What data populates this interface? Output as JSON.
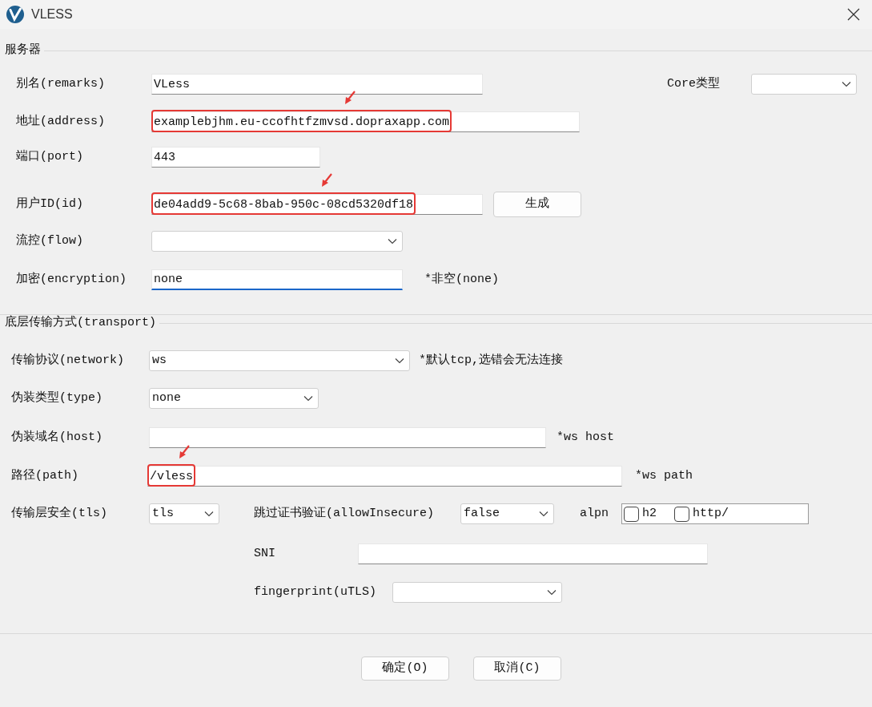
{
  "window": {
    "title": "VLESS"
  },
  "sections": [
    {
      "title": "服务器",
      "rows": [
        {
          "items": [
            {
              "kind": "label",
              "text": "别名(remarks)"
            },
            {
              "kind": "input",
              "value": "VLess",
              "highlighted": false,
              "focused": false
            },
            {
              "kind": "label",
              "text": "Core类型"
            },
            {
              "kind": "select"
            }
          ]
        },
        {
          "items": [
            {
              "kind": "label",
              "text": "地址(address)"
            },
            {
              "kind": "input",
              "value": "examplebjhm.eu-ccofhtfzmvsd.dopraxapp.com",
              "highlighted": true,
              "focused": false
            }
          ]
        },
        {
          "items": [
            {
              "kind": "label",
              "text": "端口(port)"
            },
            {
              "kind": "input",
              "value": "443",
              "highlighted": false,
              "focused": false
            }
          ]
        },
        {
          "items": [
            {
              "kind": "label",
              "text": "用户ID(id)"
            },
            {
              "kind": "input",
              "value": "de04add9-5c68-8bab-950c-08cd5320df18",
              "highlighted": true,
              "focused": false
            },
            {
              "kind": "button",
              "text": "生成"
            }
          ]
        },
        {
          "items": [
            {
              "kind": "label",
              "text": "流控(flow)"
            },
            {
              "kind": "select"
            }
          ]
        },
        {
          "items": [
            {
              "kind": "label",
              "text": "加密(encryption)"
            },
            {
              "kind": "input",
              "value": "none",
              "highlighted": false,
              "focused": true
            },
            {
              "kind": "note",
              "text": "*非空(none)"
            }
          ]
        }
      ]
    },
    {
      "title": "底层传输方式(transport)",
      "rows": [
        {
          "items": [
            {
              "kind": "label",
              "text": "传输协议(network)"
            },
            {
              "kind": "select",
              "value": "ws"
            },
            {
              "kind": "note",
              "text": "*默认tcp,选错会无法连接"
            }
          ]
        },
        {
          "items": [
            {
              "kind": "label",
              "text": "伪装类型(type)"
            },
            {
              "kind": "select",
              "value": "none"
            }
          ]
        },
        {
          "items": [
            {
              "kind": "label",
              "text": "伪装域名(host)"
            },
            {
              "kind": "input",
              "highlighted": false,
              "focused": false
            },
            {
              "kind": "note",
              "text": "*ws host"
            }
          ]
        },
        {
          "items": [
            {
              "kind": "label",
              "text": "路径(path)"
            },
            {
              "kind": "input",
              "value": "/vless",
              "highlighted": true,
              "focused": false
            },
            {
              "kind": "note",
              "text": "*ws path"
            }
          ]
        },
        {
          "items": [
            {
              "kind": "label",
              "text": "传输层安全(tls)"
            },
            {
              "kind": "select",
              "value": "tls"
            },
            {
              "kind": "label",
              "text": "跳过证书验证(allowInsecure)"
            },
            {
              "kind": "select",
              "value": "false"
            },
            {
              "kind": "label",
              "text": "alpn"
            },
            {
              "kind": "checks",
              "options": [
                {
                  "label": "h2",
                  "checked": false
                },
                {
                  "label": "http/",
                  "checked": false
                }
              ]
            }
          ]
        },
        {
          "items": [
            {
              "kind": "label",
              "text": "SNI"
            },
            {
              "kind": "input",
              "highlighted": false,
              "focused": false
            }
          ]
        },
        {
          "items": [
            {
              "kind": "label",
              "text": "fingerprint(uTLS)"
            },
            {
              "kind": "select"
            }
          ]
        }
      ]
    }
  ],
  "buttons": [
    {
      "text": "确定(O)"
    },
    {
      "text": "取消(C)"
    }
  ]
}
